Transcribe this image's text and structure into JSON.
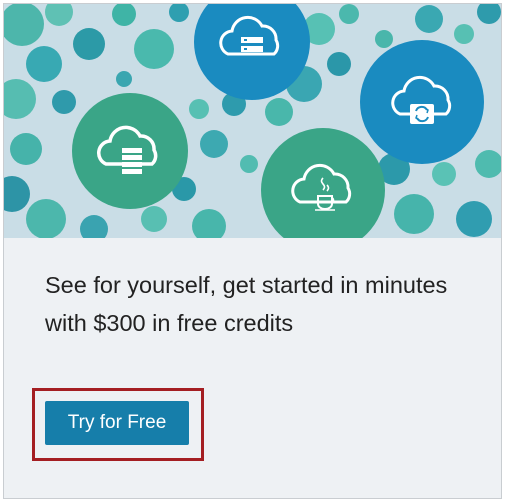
{
  "hero": {
    "icons": [
      "server-cloud-icon",
      "database-cloud-icon",
      "java-cloud-icon",
      "sync-cloud-icon"
    ]
  },
  "promo": {
    "headline": "See for yourself, get started in minutes with $300 in free credits",
    "button_label": "Try for Free"
  },
  "colors": {
    "teal_green": "#3aa587",
    "blue": "#1a8bc0",
    "button": "#167eaa",
    "highlight_border": "#a41e22",
    "panel_bg": "#eef1f4"
  }
}
